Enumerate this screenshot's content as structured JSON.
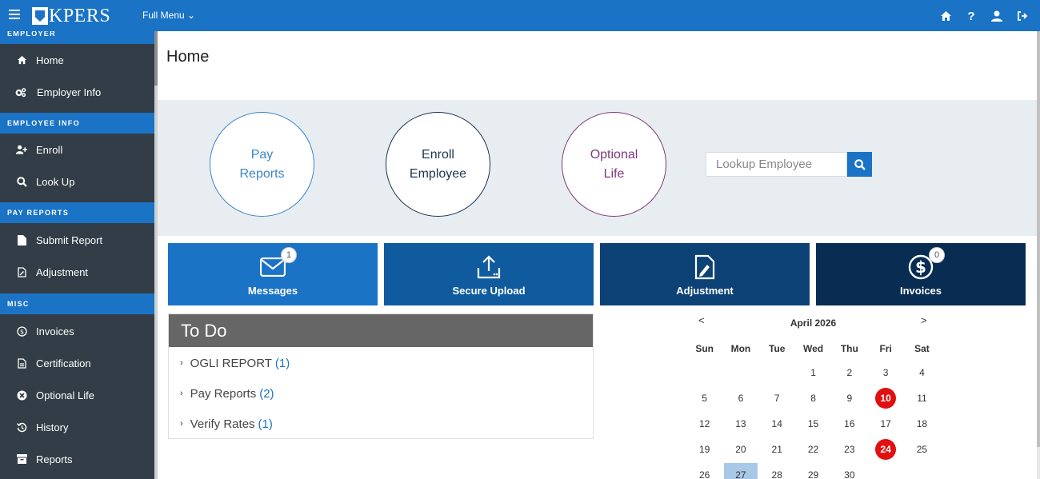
{
  "topbar": {
    "logo_text": "KPERS",
    "full_menu_label": "Full Menu",
    "icons": [
      "home-icon",
      "help-icon",
      "user-icon",
      "logout-icon"
    ]
  },
  "sidebar": {
    "sections": [
      {
        "header": "EMPLOYER",
        "items": [
          {
            "label": "Home",
            "icon": "home-icon"
          },
          {
            "label": "Employer Info",
            "icon": "gears-icon"
          }
        ]
      },
      {
        "header": "EMPLOYEE INFO",
        "items": [
          {
            "label": "Enroll",
            "icon": "user-plus-icon"
          },
          {
            "label": "Look Up",
            "icon": "search-icon"
          }
        ]
      },
      {
        "header": "PAY REPORTS",
        "items": [
          {
            "label": "Submit Report",
            "icon": "file-icon"
          },
          {
            "label": "Adjustment",
            "icon": "file-edit-icon"
          }
        ]
      },
      {
        "header": "MISC",
        "items": [
          {
            "label": "Invoices",
            "icon": "dollar-circle-icon"
          },
          {
            "label": "Certification",
            "icon": "file-lines-icon"
          },
          {
            "label": "Optional Life",
            "icon": "times-circle-icon"
          },
          {
            "label": "History",
            "icon": "history-icon"
          },
          {
            "label": "Reports",
            "icon": "archive-icon"
          }
        ]
      }
    ]
  },
  "main": {
    "title": "Home",
    "quick_links": [
      {
        "line1": "Pay",
        "line2": "Reports",
        "color": "#3a86c8"
      },
      {
        "line1": "Enroll",
        "line2": "Employee",
        "color": "#1e3550"
      },
      {
        "line1": "Optional",
        "line2": "Life",
        "color": "#7b3a7b"
      }
    ],
    "lookup": {
      "placeholder": "Lookup Employee"
    },
    "tiles": [
      {
        "label": "Messages",
        "badge": "1",
        "icon": "envelope-icon",
        "color": "#1a73c5"
      },
      {
        "label": "Secure Upload",
        "icon": "upload-icon",
        "color": "#0f5b9e"
      },
      {
        "label": "Adjustment",
        "icon": "file-edit-icon",
        "color": "#0c4275"
      },
      {
        "label": "Invoices",
        "badge": "0",
        "icon": "dollar-circle-icon",
        "color": "#082c52"
      }
    ],
    "todo": {
      "title": "To Do",
      "items": [
        {
          "label": "OGLI REPORT",
          "count": "(1)"
        },
        {
          "label": "Pay Reports",
          "count": "(2)"
        },
        {
          "label": "Verify Rates",
          "count": "(1)"
        }
      ]
    },
    "calendar": {
      "prev": "<",
      "next": ">",
      "month": "April 2026",
      "weekdays": [
        "Sun",
        "Mon",
        "Tue",
        "Wed",
        "Thu",
        "Fri",
        "Sat"
      ],
      "weeks": [
        [
          "",
          "",
          "",
          "1",
          "2",
          "3",
          "4"
        ],
        [
          "5",
          "6",
          "7",
          "8",
          "9",
          "10",
          "11"
        ],
        [
          "12",
          "13",
          "14",
          "15",
          "16",
          "17",
          "18"
        ],
        [
          "19",
          "20",
          "21",
          "22",
          "23",
          "24",
          "25"
        ],
        [
          "26",
          "27",
          "28",
          "29",
          "30",
          "",
          ""
        ]
      ],
      "event_days": [
        "10",
        "24"
      ],
      "today": "27"
    }
  }
}
